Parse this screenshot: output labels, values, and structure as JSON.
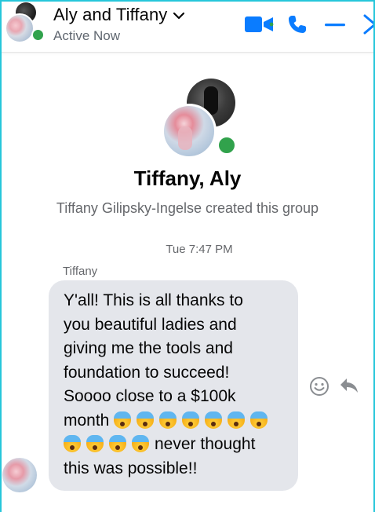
{
  "header": {
    "title": "Aly and Tiffany",
    "status": "Active Now",
    "icons": {
      "dropdown": "chevron-down-icon",
      "video": "video-call-icon",
      "call": "phone-icon",
      "minimize": "minimize-icon",
      "close": "close-icon"
    }
  },
  "group": {
    "name": "Tiffany, Aly",
    "created_text": "Tiffany Gilipsky-Ingelse created this group"
  },
  "thread": {
    "timestamp": "Tue 7:47 PM",
    "message": {
      "sender": "Tiffany",
      "line1": "Y'all! This is all thanks to",
      "line2": "you beautiful ladies and",
      "line3": "giving me the tools and",
      "line4": "foundation to succeed!",
      "line5": "Soooo close to a $100k",
      "line6_text": "month",
      "line6_emoji_count": 7,
      "line7_emoji_count": 4,
      "line7_text": "never thought",
      "line8": "this was possible!!",
      "emoji_name": "face-screaming-in-fear"
    },
    "actions": {
      "react_icon": "smiley-icon",
      "reply_icon": "reply-arrow-icon"
    }
  },
  "colors": {
    "accent": "#0a7cff",
    "online": "#31a24c",
    "bubble": "#e4e6eb",
    "secondary_text": "#65676b",
    "frame": "#26c6da"
  }
}
